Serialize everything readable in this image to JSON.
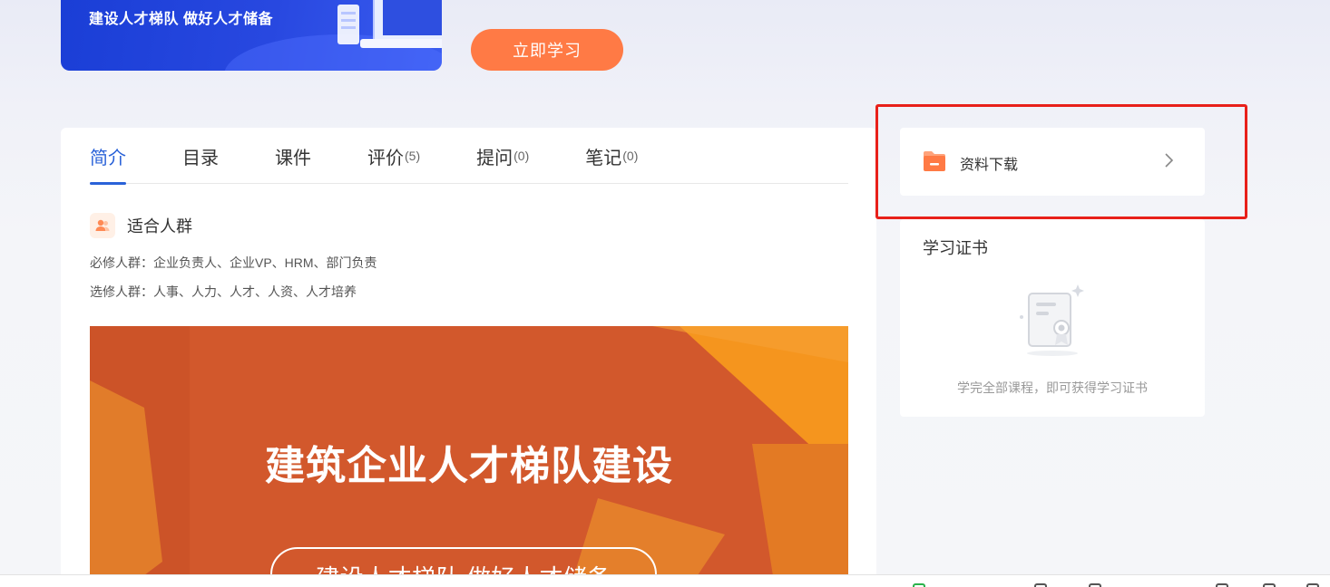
{
  "banner": {
    "slogan": "建设人才梯队 做好人才储备"
  },
  "actions": {
    "start_label": "立即学习"
  },
  "tabs": [
    {
      "label": "简介",
      "count": ""
    },
    {
      "label": "目录",
      "count": ""
    },
    {
      "label": "课件",
      "count": ""
    },
    {
      "label": "评价",
      "count": "(5)"
    },
    {
      "label": "提问",
      "count": "(0)"
    },
    {
      "label": "笔记",
      "count": "(0)"
    }
  ],
  "intro": {
    "section_title": "适合人群",
    "required_line": "必修人群：企业负责人、企业VP、HRM、部门负责",
    "optional_line": "选修人群：人事、人力、人才、人资、人才培养"
  },
  "poster": {
    "title": "建筑企业人才梯队建设",
    "subtitle": "建设人才梯队 做好人才储备"
  },
  "sidebar": {
    "download_label": "资料下载",
    "certificate_title": "学习证书",
    "certificate_hint": "学完全部课程，即可获得学习证书"
  },
  "colors": {
    "accent_blue": "#2a62d8",
    "accent_orange": "#ff7a45",
    "highlight_red": "#e8201a",
    "poster_orange": "#d2582c"
  }
}
